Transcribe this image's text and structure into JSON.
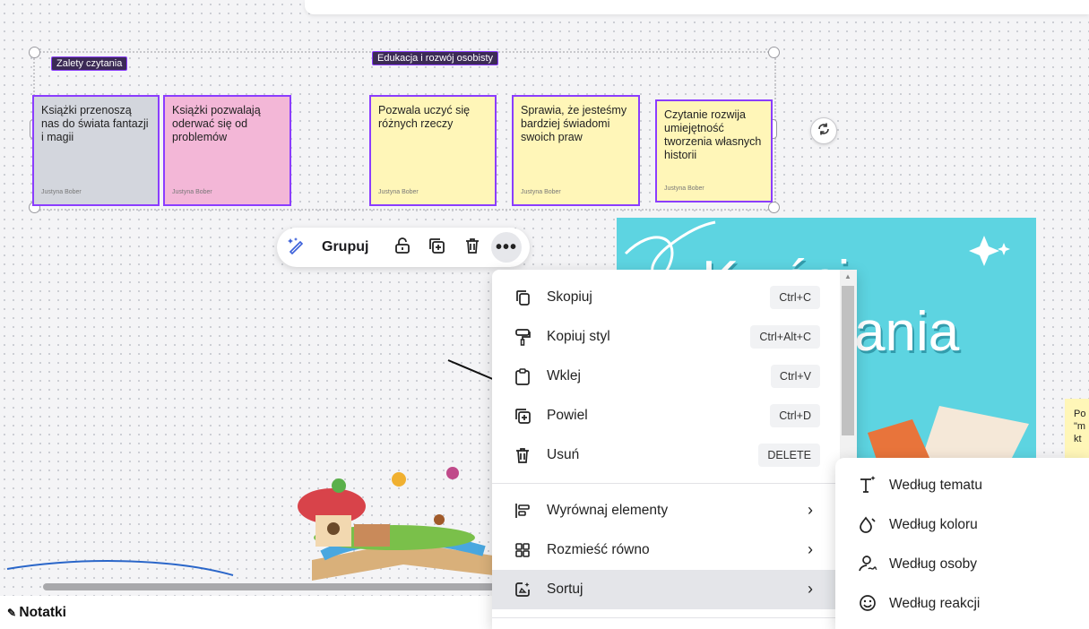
{
  "colors": {
    "accent": "#8b3dff",
    "note_gray": "#d3d6dd",
    "note_pink": "#f3b7d7",
    "note_yellow": "#fff6b8",
    "poster": "#5dd4e1"
  },
  "canvas": {
    "tags": [
      "Zalety czytania",
      "Edukacja i rozwój osobisty"
    ],
    "notes": [
      {
        "text": "Książki przenoszą nas do świata fantazji i magii",
        "author": "Justyna Bober",
        "color": "gray"
      },
      {
        "text": "Książki pozwalają oderwać się od problemów",
        "author": "Justyna Bober",
        "color": "pink"
      },
      {
        "text": "Pozwala uczyć się różnych rzeczy",
        "author": "Justyna Bober",
        "color": "yellow"
      },
      {
        "text": "Sprawia, że jesteśmy bardziej świadomi swoich praw",
        "author": "Justyna Bober",
        "color": "yellow"
      },
      {
        "text": "Czytanie rozwija umiejętność tworzenia własnych historii",
        "author": "Justyna Bober",
        "color": "yellow"
      }
    ],
    "poster": {
      "line1": "K  yści",
      "line2": "ania"
    },
    "peek_note": {
      "lines": [
        "Po",
        "\"m",
        "kt"
      ]
    }
  },
  "toolbar": {
    "group_label": "Grupuj"
  },
  "context_menu": {
    "items": [
      {
        "label": "Skopiuj",
        "shortcut": "Ctrl+C",
        "icon": "copy-icon"
      },
      {
        "label": "Kopiuj styl",
        "shortcut": "Ctrl+Alt+C",
        "icon": "paint-roller-icon"
      },
      {
        "label": "Wklej",
        "shortcut": "Ctrl+V",
        "icon": "clipboard-icon"
      },
      {
        "label": "Powiel",
        "shortcut": "Ctrl+D",
        "icon": "duplicate-icon"
      },
      {
        "label": "Usuń",
        "shortcut": "DELETE",
        "icon": "trash-icon"
      }
    ],
    "sub_items": [
      {
        "label": "Wyrównaj elementy",
        "icon": "align-icon"
      },
      {
        "label": "Rozmieść równo",
        "icon": "grid-icon"
      },
      {
        "label": "Sortuj",
        "icon": "sort-icon",
        "highlighted": true
      }
    ]
  },
  "sort_submenu": {
    "items": [
      {
        "label": "Według tematu",
        "icon": "text-sparkle-icon"
      },
      {
        "label": "Według koloru",
        "icon": "droplet-icon"
      },
      {
        "label": "Według osoby",
        "icon": "person-icon"
      },
      {
        "label": "Według reakcji",
        "icon": "smiley-icon"
      }
    ]
  },
  "notes_bar": {
    "label": "Notatki"
  }
}
